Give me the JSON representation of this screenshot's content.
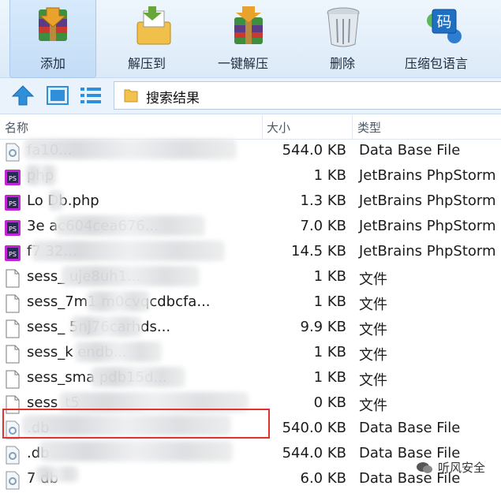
{
  "toolbar": {
    "buttons": [
      {
        "label": "添加",
        "icon": "add-archive-icon",
        "active": true
      },
      {
        "label": "解压到",
        "icon": "extract-to-icon",
        "active": false
      },
      {
        "label": "一键解压",
        "icon": "one-click-extract-icon",
        "active": false
      },
      {
        "label": "删除",
        "icon": "delete-icon",
        "active": false
      },
      {
        "label": "压缩包语言",
        "icon": "archive-language-icon",
        "active": false
      }
    ],
    "lang_icon_text": "码"
  },
  "address": {
    "path": "搜索结果"
  },
  "columns": {
    "name": "名称",
    "size": "大小",
    "type": "类型"
  },
  "files": [
    {
      "name": "fa10...",
      "size": "544.0 KB",
      "type": "Data Base File",
      "icon": "db"
    },
    {
      "name": "php",
      "size": "1 KB",
      "type": "JetBrains PhpStorm",
      "icon": "ps"
    },
    {
      "name": "Lo  Db.php",
      "size": "1.3 KB",
      "type": "JetBrains PhpStorm",
      "icon": "ps"
    },
    {
      "name": "3e                  ac604cea676...",
      "size": "7.0 KB",
      "type": "JetBrains PhpStorm",
      "icon": "ps"
    },
    {
      "name": "f7                             32...",
      "size": "14.5 KB",
      "type": "JetBrains PhpStorm",
      "icon": "ps"
    },
    {
      "name": "sess_                       uje8uh1...",
      "size": "1 KB",
      "type": "文件",
      "icon": "file"
    },
    {
      "name": "sess_7m1           m0cvqcdbcfa...",
      "size": "1 KB",
      "type": "文件",
      "icon": "file"
    },
    {
      "name": "sess_             5nj76carhds...",
      "size": "9.9 KB",
      "type": "文件",
      "icon": "file"
    },
    {
      "name": "sess_k                      endb...",
      "size": "1 KB",
      "type": "文件",
      "icon": "file"
    },
    {
      "name": "sess_sma                 pdb15d...",
      "size": "1 KB",
      "type": "文件",
      "icon": "file"
    },
    {
      "name": "sess_t5",
      "size": "0 KB",
      "type": "文件",
      "icon": "file"
    },
    {
      "name": ".db",
      "size": "540.0 KB",
      "type": "Data Base File",
      "icon": "db"
    },
    {
      "name": ".db",
      "size": "544.0 KB",
      "type": "Data Base File",
      "icon": "db"
    },
    {
      "name": "7           db",
      "size": "6.0 KB",
      "type": "Data Base File",
      "icon": "db"
    }
  ],
  "watermark": {
    "text": "听风安全"
  },
  "colors": {
    "ps_icon": "#2c2a52",
    "ps_accent": "#c026d3",
    "highlight": "#e0322f",
    "toolbar_bg": "#dbeaf8"
  }
}
